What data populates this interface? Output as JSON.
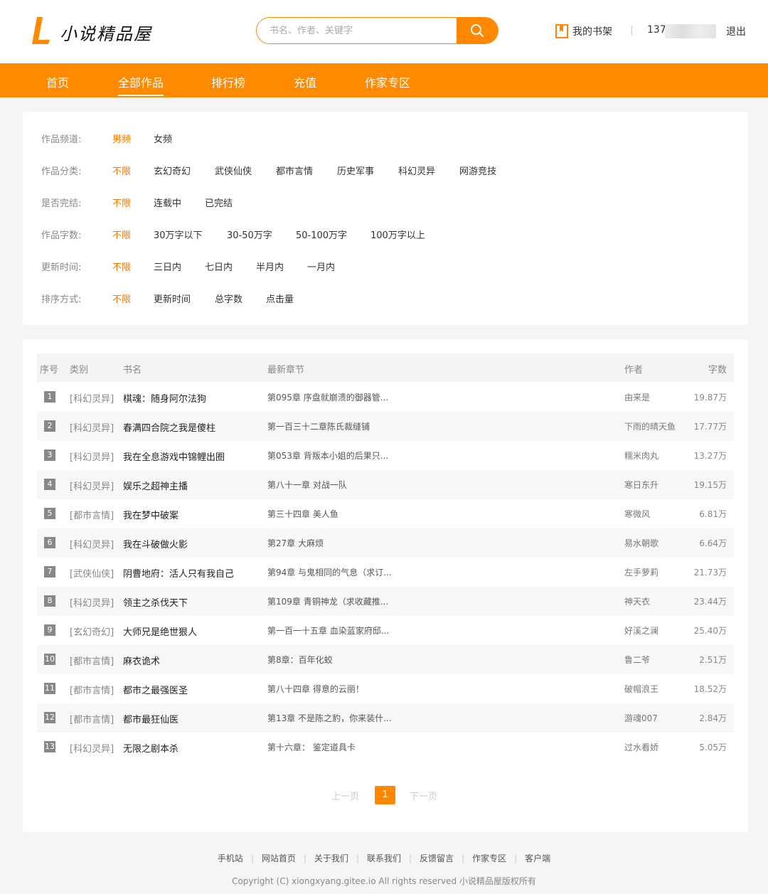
{
  "header": {
    "logo_text": "小说精品屋",
    "search_placeholder": "书名、作者、关键字",
    "shelf_label": "我的书架",
    "separator": "|",
    "user_prefix": "137",
    "logout_label": "退出"
  },
  "nav": {
    "items": [
      {
        "label": "首页",
        "active": false
      },
      {
        "label": "全部作品",
        "active": true
      },
      {
        "label": "排行榜",
        "active": false
      },
      {
        "label": "充值",
        "active": false
      },
      {
        "label": "作家专区",
        "active": false
      }
    ]
  },
  "filters": [
    {
      "label": "作品频道:",
      "options": [
        "男频",
        "女频"
      ],
      "active": 0
    },
    {
      "label": "作品分类:",
      "options": [
        "不限",
        "玄幻奇幻",
        "武侠仙侠",
        "都市言情",
        "历史军事",
        "科幻灵异",
        "网游竞技"
      ],
      "active": 0
    },
    {
      "label": "是否完结:",
      "options": [
        "不限",
        "连载中",
        "已完结"
      ],
      "active": 0
    },
    {
      "label": "作品字数:",
      "options": [
        "不限",
        "30万字以下",
        "30-50万字",
        "50-100万字",
        "100万字以上"
      ],
      "active": 0
    },
    {
      "label": "更新时间:",
      "options": [
        "不限",
        "三日内",
        "七日内",
        "半月内",
        "一月内"
      ],
      "active": 0
    },
    {
      "label": "排序方式:",
      "options": [
        "不限",
        "更新时间",
        "总字数",
        "点击量"
      ],
      "active": 0
    }
  ],
  "table": {
    "headers": {
      "no": "序号",
      "category": "类别",
      "name": "书名",
      "chapter": "最新章节",
      "author": "作者",
      "words": "字数"
    },
    "rows": [
      {
        "no": "1",
        "category": "[科幻灵异]",
        "name": "棋魂：随身阿尔法狗",
        "chapter": "第095章 序盘就崩溃的御器管...",
        "author": "由来是",
        "words": "19.87万"
      },
      {
        "no": "2",
        "category": "[科幻灵异]",
        "name": "春满四合院之我是傻柱",
        "chapter": "第一百三十二章陈氏裁缝铺",
        "author": "下雨的晴天鱼",
        "words": "17.77万"
      },
      {
        "no": "3",
        "category": "[科幻灵异]",
        "name": "我在全息游戏中锦鲤出圈",
        "chapter": "第053章 背叛本小姐的后果只...",
        "author": "糯米肉丸",
        "words": "13.27万"
      },
      {
        "no": "4",
        "category": "[科幻灵异]",
        "name": "娱乐之超神主播",
        "chapter": "第八十一章 对战一队",
        "author": "寒日东升",
        "words": "19.15万"
      },
      {
        "no": "5",
        "category": "[都市言情]",
        "name": "我在梦中破案",
        "chapter": "第三十四章 美人鱼",
        "author": "寒微风",
        "words": "6.81万"
      },
      {
        "no": "6",
        "category": "[科幻灵异]",
        "name": "我在斗破做火影",
        "chapter": "第27章 大麻烦",
        "author": "易水朝歌",
        "words": "6.64万"
      },
      {
        "no": "7",
        "category": "[武侠仙侠]",
        "name": "阴曹地府：活人只有我自己",
        "chapter": "第94章 与鬼相同的气息（求订...",
        "author": "左手萝莉",
        "words": "21.73万"
      },
      {
        "no": "8",
        "category": "[科幻灵异]",
        "name": "领主之杀伐天下",
        "chapter": "第109章 青铜神龙（求收藏推...",
        "author": "神天衣",
        "words": "23.44万"
      },
      {
        "no": "9",
        "category": "[玄幻奇幻]",
        "name": "大师兄是绝世狠人",
        "chapter": "第一百一十五章 血染蓝家府邸...",
        "author": "好溪之澜",
        "words": "25.40万"
      },
      {
        "no": "10",
        "category": "[都市言情]",
        "name": "麻衣诡术",
        "chapter": "第8章：百年化蛟",
        "author": "鲁二爷",
        "words": "2.51万"
      },
      {
        "no": "11",
        "category": "[都市言情]",
        "name": "都市之最强医圣",
        "chapter": "第八十四章 得意的云丽！",
        "author": "破帽浪王",
        "words": "18.52万"
      },
      {
        "no": "12",
        "category": "[都市言情]",
        "name": "都市最狂仙医",
        "chapter": "第13章 不是陈之豹，你来装什...",
        "author": "游魂007",
        "words": "2.84万"
      },
      {
        "no": "13",
        "category": "[科幻灵异]",
        "name": "无限之剧本杀",
        "chapter": "第十六章：  鉴定道具卡",
        "author": "过水看娇",
        "words": "5.05万"
      }
    ]
  },
  "pagination": {
    "prev": "上一页",
    "current": "1",
    "next": "下一页"
  },
  "footer": {
    "links": [
      "手机站",
      "网站首页",
      "关于我们",
      "联系我们",
      "反馈留言",
      "作家专区",
      "客户端"
    ],
    "copyright": "Copyright (C) xiongxyang.gitee.io All rights reserved  小说精品屋版权所有"
  },
  "colors": {
    "accent": "#ff8a00",
    "active_text": "#ff7700"
  },
  "icons": {
    "search": "search-icon",
    "shelf": "bookshelf-icon",
    "logo": "logo-l-icon"
  }
}
